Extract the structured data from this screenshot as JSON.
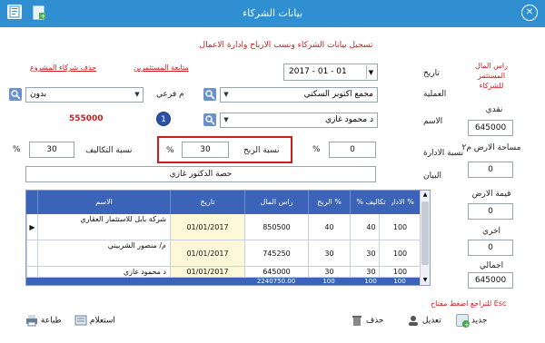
{
  "window": {
    "title": "بيانات الشركاء"
  },
  "header": {
    "subtitle": "تسجيل بيانات الشركاء ونسب الارباح وادارة الاعمال",
    "links": {
      "follow_investors": "متابعة المستثمرين",
      "delete_project_partners": "حذف شركاء المشروع"
    }
  },
  "right_panel": {
    "capital_label": "راس المال المستثمر للشركاء",
    "cash_label": "نقدي",
    "cash_value": "645000",
    "land_area_label": "مساحة الارض م٢",
    "land_area_value": "0",
    "land_value_label": "قيمة الارض",
    "land_value_value": "0",
    "other_label": "اخري",
    "other_value": "0",
    "total_label": "اجمالي",
    "total_value": "645000"
  },
  "form": {
    "date_label": "تاريخ",
    "date_value": "2017 - 01 - 01",
    "operation_label": "العملية",
    "operation_value": "مجمع اكتوبر السكني",
    "name_label": "الاسم",
    "name_value": "د محمود غازي",
    "sub_label": "م فرعي",
    "sub_value": "بدون",
    "amount_display": "555000",
    "admin_ratio_label": "نسبة الادارة",
    "admin_ratio_value": "0",
    "percent_sign": "%",
    "profit_ratio_label": "نسبة الربح",
    "profit_ratio_value": "30",
    "cost_ratio_label": "نسبة التكاليف",
    "cost_ratio_value": "30",
    "statement_label": "البيان",
    "statement_value": "حصة الدكتور غازي"
  },
  "grid": {
    "columns": [
      "الادارة %",
      "% تكاليف",
      "الربح %",
      "راس المال",
      "تاريخ",
      "الاسم"
    ],
    "rows": [
      {
        "admin": "100",
        "cost": "40",
        "profit": "40",
        "capital": "850500",
        "date": "01/01/2017",
        "name": "شركة بابل للاستثمار العقاري"
      },
      {
        "admin": "100",
        "cost": "30",
        "profit": "30",
        "capital": "745250",
        "date": "01/01/2017",
        "name": "م/ منصور الشربيني"
      },
      {
        "admin": "100",
        "cost": "30",
        "profit": "30",
        "capital": "645000",
        "date": "01/01/2017",
        "name": "د محمود غازي"
      }
    ],
    "footer": {
      "admin": "100",
      "cost": "100",
      "profit": "100",
      "capital": "2240750.00"
    }
  },
  "hint": "للتراجع اضغط مفتاح Esc",
  "toolbar": {
    "new": "جديد",
    "edit": "تعديل",
    "delete": "حذف",
    "query": "استعلام",
    "print": "طباعة"
  },
  "annotation": {
    "badge": "1"
  },
  "colors": {
    "titlebar": "#2f8fd0",
    "grid_header": "#3b64b8",
    "highlight_red": "#d21c1c",
    "date_cell_bg": "#fdf8d8"
  },
  "icons": {
    "app": "app-icon",
    "close": "close-icon",
    "search": "search-icon"
  }
}
